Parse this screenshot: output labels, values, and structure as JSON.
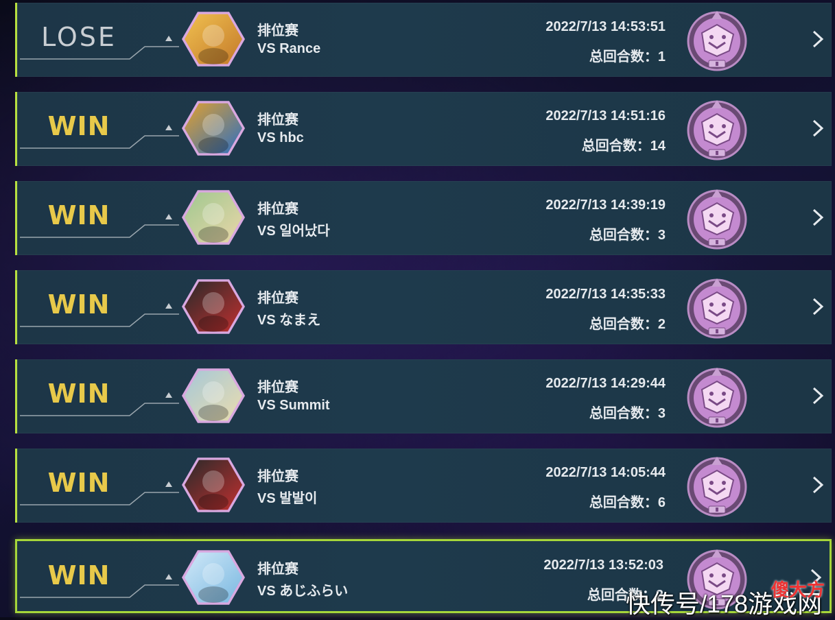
{
  "matches": [
    {
      "result": "LOSE",
      "mode": "排位赛",
      "opponent": "VS Rance",
      "time": "2022/7/13 14:53:51",
      "rounds": "总回合数：1",
      "avatar": "kuriboh-avatar-icon",
      "avatar_colors": [
        "#c47a2a",
        "#f0c050"
      ],
      "selected": false
    },
    {
      "result": "WIN",
      "mode": "排位赛",
      "opponent": "VS hbc",
      "time": "2022/7/13 14:51:16",
      "rounds": "总回合数：14",
      "avatar": "robot-avatar-icon",
      "avatar_colors": [
        "#2e6fc0",
        "#e0a030"
      ],
      "selected": false
    },
    {
      "result": "WIN",
      "mode": "排位赛",
      "opponent": "VS 일어났다",
      "time": "2022/7/13 14:39:19",
      "rounds": "总回合数：3",
      "avatar": "blonde-girl-avatar-icon",
      "avatar_colors": [
        "#e9d6a8",
        "#a0c890"
      ],
      "selected": false
    },
    {
      "result": "WIN",
      "mode": "排位赛",
      "opponent": "VS なまえ",
      "time": "2022/7/13 14:35:33",
      "rounds": "总回合数：2",
      "avatar": "red-cap-avatar-icon",
      "avatar_colors": [
        "#c03030",
        "#2a2a2a"
      ],
      "selected": false
    },
    {
      "result": "WIN",
      "mode": "排位赛",
      "opponent": "VS Summit",
      "time": "2022/7/13 14:29:44",
      "rounds": "总回合数：3",
      "avatar": "blonde-girl-avatar-icon",
      "avatar_colors": [
        "#eadcae",
        "#a6c8d8"
      ],
      "selected": false
    },
    {
      "result": "WIN",
      "mode": "排位赛",
      "opponent": "VS 발발이",
      "time": "2022/7/13 14:05:44",
      "rounds": "总回合数：6",
      "avatar": "red-cap-avatar-icon",
      "avatar_colors": [
        "#c03030",
        "#2a2a2a"
      ],
      "selected": false
    },
    {
      "result": "WIN",
      "mode": "排位赛",
      "opponent": "VS あじふらい",
      "time": "2022/7/13 13:52:03",
      "rounds": "总回合数：2",
      "avatar": "blue-dragon-avatar-icon",
      "avatar_colors": [
        "#7ab8e0",
        "#d0e8f8"
      ],
      "selected": true
    }
  ],
  "rank_badge_icon": "wolf-rank-badge-icon",
  "rank_badge_colors": [
    "#c48ad0",
    "#f4d8f2"
  ],
  "colors": {
    "win": "#e8c94a",
    "lose": "#c9ced3",
    "selected_border": "#a6d63a",
    "row_bg": "#1e3a4c"
  },
  "watermark": {
    "text": "快传号/178游戏网",
    "tag": "傻大方"
  }
}
